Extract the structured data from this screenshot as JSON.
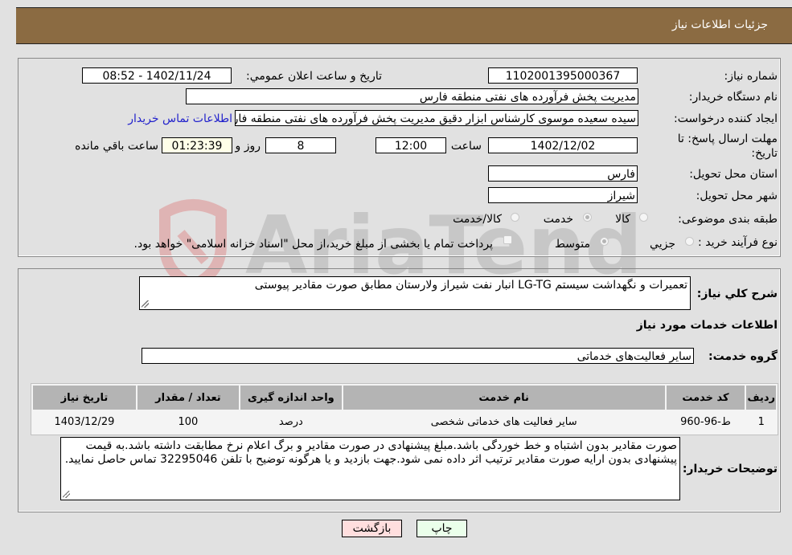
{
  "header": {
    "title": "جزئیات اطلاعات نیاز"
  },
  "form": {
    "need_number": {
      "label": "شماره نیاز:",
      "value": "1102001395000367"
    },
    "announce_datetime": {
      "label": "تاريخ و ساعت اعلان عمومي:",
      "value": "1402/11/24 - 08:52"
    },
    "buyer_org": {
      "label": "نام دستگاه خريدار:",
      "value": "مديريت پخش فرآورده هاى نفتى منطقه فارس"
    },
    "requester": {
      "label": "ايجاد کننده درخواست:",
      "value": "سیده سعیده موسوی کارشناس ابزار دقیق مديريت پخش فرآورده هاى نفتى منطقه فارس",
      "contact_link": "اطلاعات تماس خريدار"
    },
    "deadline": {
      "label": "مهلت ارسال پاسخ: تا تاریخ:",
      "date": "1402/12/02",
      "time_label": "ساعت",
      "time": "12:00",
      "days": "8",
      "days_label": "روز و",
      "remaining": "01:23:39",
      "remaining_label": "ساعت باقي مانده"
    },
    "province": {
      "label": "استان محل تحویل:",
      "value": "فارس"
    },
    "city": {
      "label": "شهر محل تحویل:",
      "value": "شيراز"
    },
    "category": {
      "label": "طبقه بندی موضوعی:",
      "options": [
        {
          "label": "کالا",
          "checked": false
        },
        {
          "label": "خدمت",
          "checked": true
        },
        {
          "label": "کالا/خدمت",
          "checked": false
        }
      ]
    },
    "purchase_type": {
      "label": "نوع فرآیند خرید :",
      "options": [
        {
          "label": "جزيي",
          "checked": false
        },
        {
          "label": "متوسط",
          "checked": true
        }
      ],
      "treasury_note": "پرداخت تمام یا بخشی از مبلغ خرید،از محل \"اسناد خزانه اسلامی\" خواهد بود."
    }
  },
  "details": {
    "summary_label": "شرح کلي نياز:",
    "summary_value": "تعمیرات و نگهداشت سیستم LG-TG انبار نفت شیراز ولارستان مطابق صورت مقادیر پیوستی",
    "services_title": "اطلاعات خدمات مورد نياز",
    "service_group_label": "گروه خدمت:",
    "service_group_value": "سایر فعالیت‌های خدماتی",
    "table": {
      "headers": [
        "رديف",
        "کد خدمت",
        "نام خدمت",
        "واحد اندازه گيری",
        "تعداد / مقدار",
        "تاريخ نياز"
      ],
      "rows": [
        [
          "1",
          "ط-96-960",
          "سایر فعالیت های خدماتی شخصی",
          "درصد",
          "100",
          "1403/12/29"
        ]
      ]
    },
    "buyer_notes_label": "توضيحات خريدار:",
    "buyer_notes_value": "صورت مقادیر بدون اشتباه و خط خوردگی باشد.مبلغ پیشنهادی در صورت مقادیر و برگ اعلام نرخ مطابقت داشته باشد.به قیمت پیشنهادی بدون ارایه صورت مقادیر ترتیب اثر داده نمی شود.جهت بازدید و یا هرگونه توضیح با تلفن 32295046 تماس حاصل نمایید."
  },
  "buttons": {
    "print": "چاپ",
    "back": "بازگشت"
  },
  "colors": {
    "header_bg": "#8b6b42",
    "print_bg": "#eaffea",
    "back_bg": "#ffdede",
    "link": "#2222cc"
  }
}
